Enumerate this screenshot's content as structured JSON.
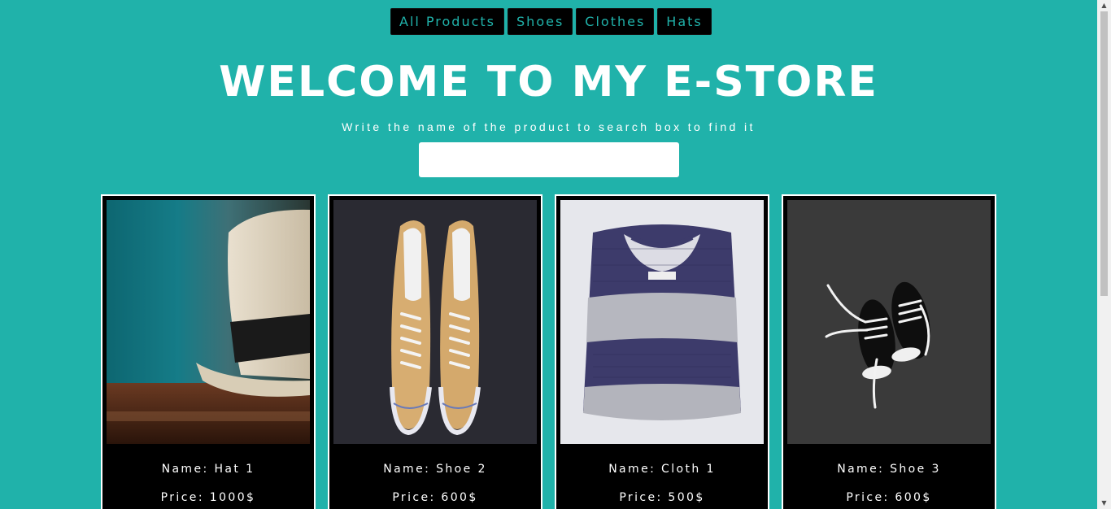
{
  "nav": {
    "items": [
      {
        "label": "All Products"
      },
      {
        "label": "Shoes"
      },
      {
        "label": "Clothes"
      },
      {
        "label": "Hats"
      }
    ]
  },
  "header": {
    "title": "WELCOME TO MY E-STORE",
    "subtitle": "Write the name of the product to search box to find it"
  },
  "search": {
    "value": "",
    "placeholder": ""
  },
  "products": [
    {
      "name": "Name: Hat 1",
      "price": "Price: 1000$",
      "image_icon": "hat-photo"
    },
    {
      "name": "Name: Shoe 2",
      "price": "Price: 600$",
      "image_icon": "sneakers-photo"
    },
    {
      "name": "Name: Cloth 1",
      "price": "Price: 500$",
      "image_icon": "sweater-photo"
    },
    {
      "name": "Name: Shoe 3",
      "price": "Price: 600$",
      "image_icon": "black-sneakers-photo"
    }
  ],
  "colors": {
    "background": "#20b2aa",
    "nav_text": "#20b2aa",
    "card_bg": "#000000",
    "text": "#ffffff"
  }
}
